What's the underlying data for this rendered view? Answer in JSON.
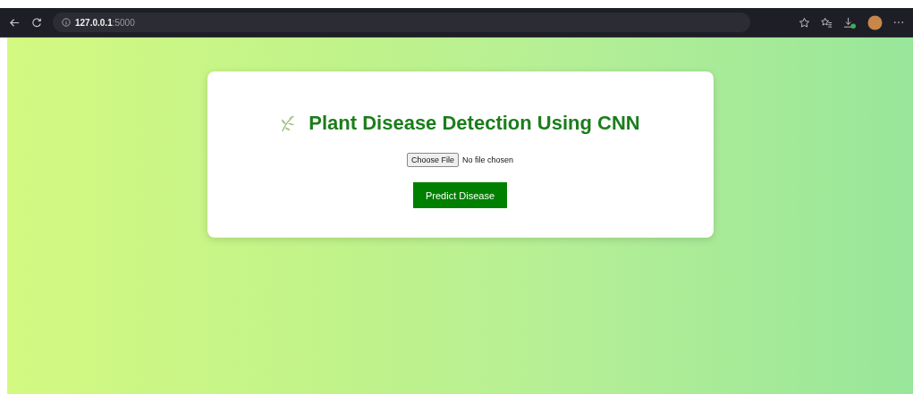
{
  "browser": {
    "address": "**127.0.0.1**:5000"
  },
  "card": {
    "title": "Plant Disease Detection Using CNN",
    "file_button": "Choose File",
    "file_status": "No file chosen",
    "submit": "Predict Disease"
  }
}
